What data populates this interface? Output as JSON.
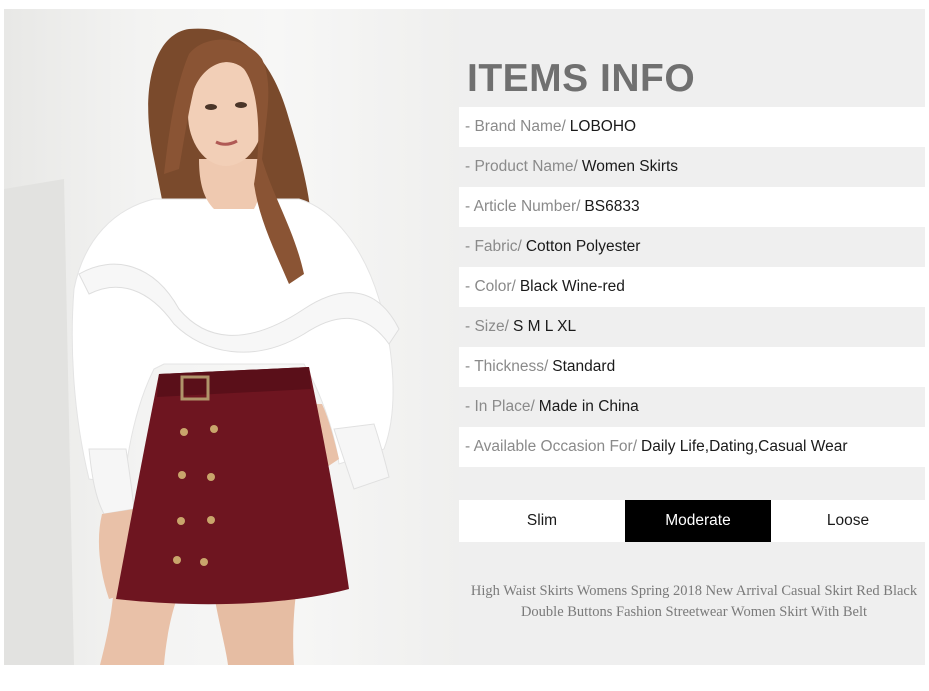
{
  "title": "ITEMS INFO",
  "specs": [
    {
      "label": "- Brand Name/",
      "value": "LOBOHO"
    },
    {
      "label": "- Product Name/",
      "value": "Women Skirts"
    },
    {
      "label": "- Article Number/",
      "value": "BS6833"
    },
    {
      "label": "- Fabric/",
      "value": "Cotton Polyester"
    },
    {
      "label": "- Color/",
      "value": "Black Wine-red"
    },
    {
      "label": "- Size/",
      "value": "S M L XL"
    },
    {
      "label": "- Thickness/",
      "value": "Standard"
    },
    {
      "label": "- In Place/",
      "value": "Made in China"
    },
    {
      "label": "- Available Occasion For/",
      "value": "Daily Life,Dating,Casual Wear"
    }
  ],
  "fit": {
    "options": [
      "Slim",
      "Moderate",
      "Loose"
    ],
    "selected": "Moderate"
  },
  "description": "High Waist Skirts Womens Spring 2018 New Arrival Casual Skirt Red Black Double Buttons Fashion Streetwear Women Skirt With Belt",
  "colors": {
    "skirt": "#6e1520",
    "selected_fit": "#000000",
    "title": "#707070"
  }
}
